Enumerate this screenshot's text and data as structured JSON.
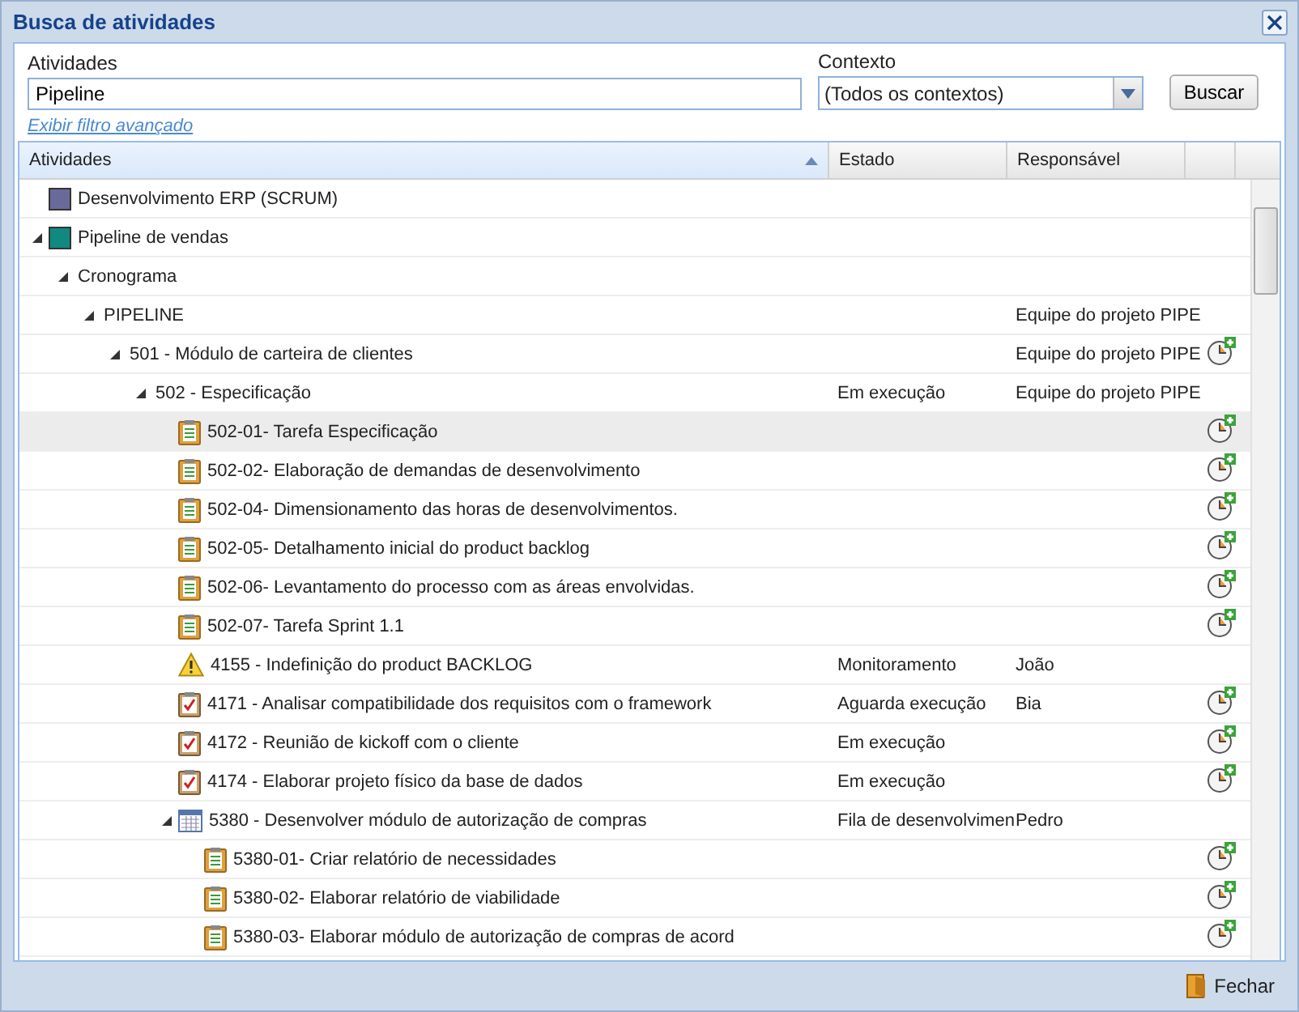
{
  "window": {
    "title": "Busca de atividades"
  },
  "filter": {
    "activities_label": "Atividades",
    "activities_value": "Pipeline",
    "context_label": "Contexto",
    "context_value": "(Todos os contextos)",
    "search_button": "Buscar",
    "advanced_link": "Exibir filtro avançado"
  },
  "table": {
    "columns": [
      {
        "label": "Atividades",
        "sorted": true
      },
      {
        "label": "Estado",
        "sorted": false
      },
      {
        "label": "Responsável",
        "sorted": false
      }
    ],
    "rows": [
      {
        "kind": "color-square",
        "color": "#6a6a9a",
        "text": "Desenvolvimento ERP (SCRUM)",
        "hovered": false,
        "timer": false
      },
      {
        "kind": "color-square",
        "color": "#108a80",
        "text": "Pipeline de vendas",
        "expanded": true,
        "hovered": false,
        "timer": false,
        "children": [
          {
            "text": "Cronograma",
            "expanded": true,
            "hovered": false,
            "timer": false,
            "children": [
              {
                "text": "PIPELINE",
                "responsible": "Equipe do projeto PIPE",
                "expanded": true,
                "hovered": false,
                "timer": false,
                "children": [
                  {
                    "text": "501 - Módulo de carteira de clientes",
                    "responsible": "Equipe do projeto PIPE",
                    "expanded": true,
                    "hovered": false,
                    "timer": true,
                    "children": [
                      {
                        "text": "502 - Especificação",
                        "state": "Em execução",
                        "responsible": "Equipe do projeto PIPE",
                        "expanded": true,
                        "hovered": false,
                        "timer": false,
                        "children": [
                          {
                            "kind": "task",
                            "text": "502-01- Tarefa Especificação",
                            "hovered": true,
                            "timer": true
                          },
                          {
                            "kind": "task",
                            "text": "502-02- Elaboração de demandas de desenvolvimento",
                            "hovered": false,
                            "timer": true
                          },
                          {
                            "kind": "task",
                            "text": "502-04- Dimensionamento das horas de desenvolvimentos.",
                            "hovered": false,
                            "timer": true
                          },
                          {
                            "kind": "task",
                            "text": "502-05- Detalhamento inicial do product backlog",
                            "hovered": false,
                            "timer": true
                          },
                          {
                            "kind": "task",
                            "text": "502-06- Levantamento do processo com as áreas envolvidas.",
                            "hovered": false,
                            "timer": true
                          },
                          {
                            "kind": "task",
                            "text": "502-07- Tarefa Sprint 1.1",
                            "hovered": false,
                            "timer": true
                          },
                          {
                            "kind": "warning",
                            "text": "4155 - Indefinição do product BACKLOG",
                            "state": "Monitoramento",
                            "responsible": "João",
                            "hovered": false,
                            "timer": false
                          },
                          {
                            "kind": "checked-task",
                            "text": "4171 - Analisar compatibilidade dos requisitos com o framework",
                            "state": "Aguarda execução",
                            "responsible": "Bia",
                            "hovered": false,
                            "timer": true
                          },
                          {
                            "kind": "checked-task",
                            "text": "4172 - Reunião de kickoff com o cliente",
                            "state": "Em execução",
                            "hovered": false,
                            "timer": true
                          },
                          {
                            "kind": "checked-task",
                            "text": "4174 - Elaborar projeto físico da base de dados",
                            "state": "Em execução",
                            "hovered": false,
                            "timer": true
                          },
                          {
                            "kind": "calendar",
                            "text": "5380 - Desenvolver módulo de autorização de compras",
                            "state": "Fila de desenvolvimen",
                            "responsible": "Pedro",
                            "expanded": true,
                            "hovered": false,
                            "timer": false,
                            "children": [
                              {
                                "kind": "task",
                                "text": "5380-01- Criar relatório de necessidades",
                                "hovered": false,
                                "timer": true
                              },
                              {
                                "kind": "task",
                                "text": "5380-02- Elaborar relatório de viabilidade",
                                "hovered": false,
                                "timer": true
                              },
                              {
                                "kind": "task",
                                "text": "5380-03- Elaborar módulo de autorização de compras de acord",
                                "hovered": false,
                                "timer": true
                              }
                            ]
                          }
                        ]
                      }
                    ]
                  }
                ]
              }
            ]
          }
        ]
      }
    ]
  },
  "footer": {
    "close_button": "Fechar"
  }
}
